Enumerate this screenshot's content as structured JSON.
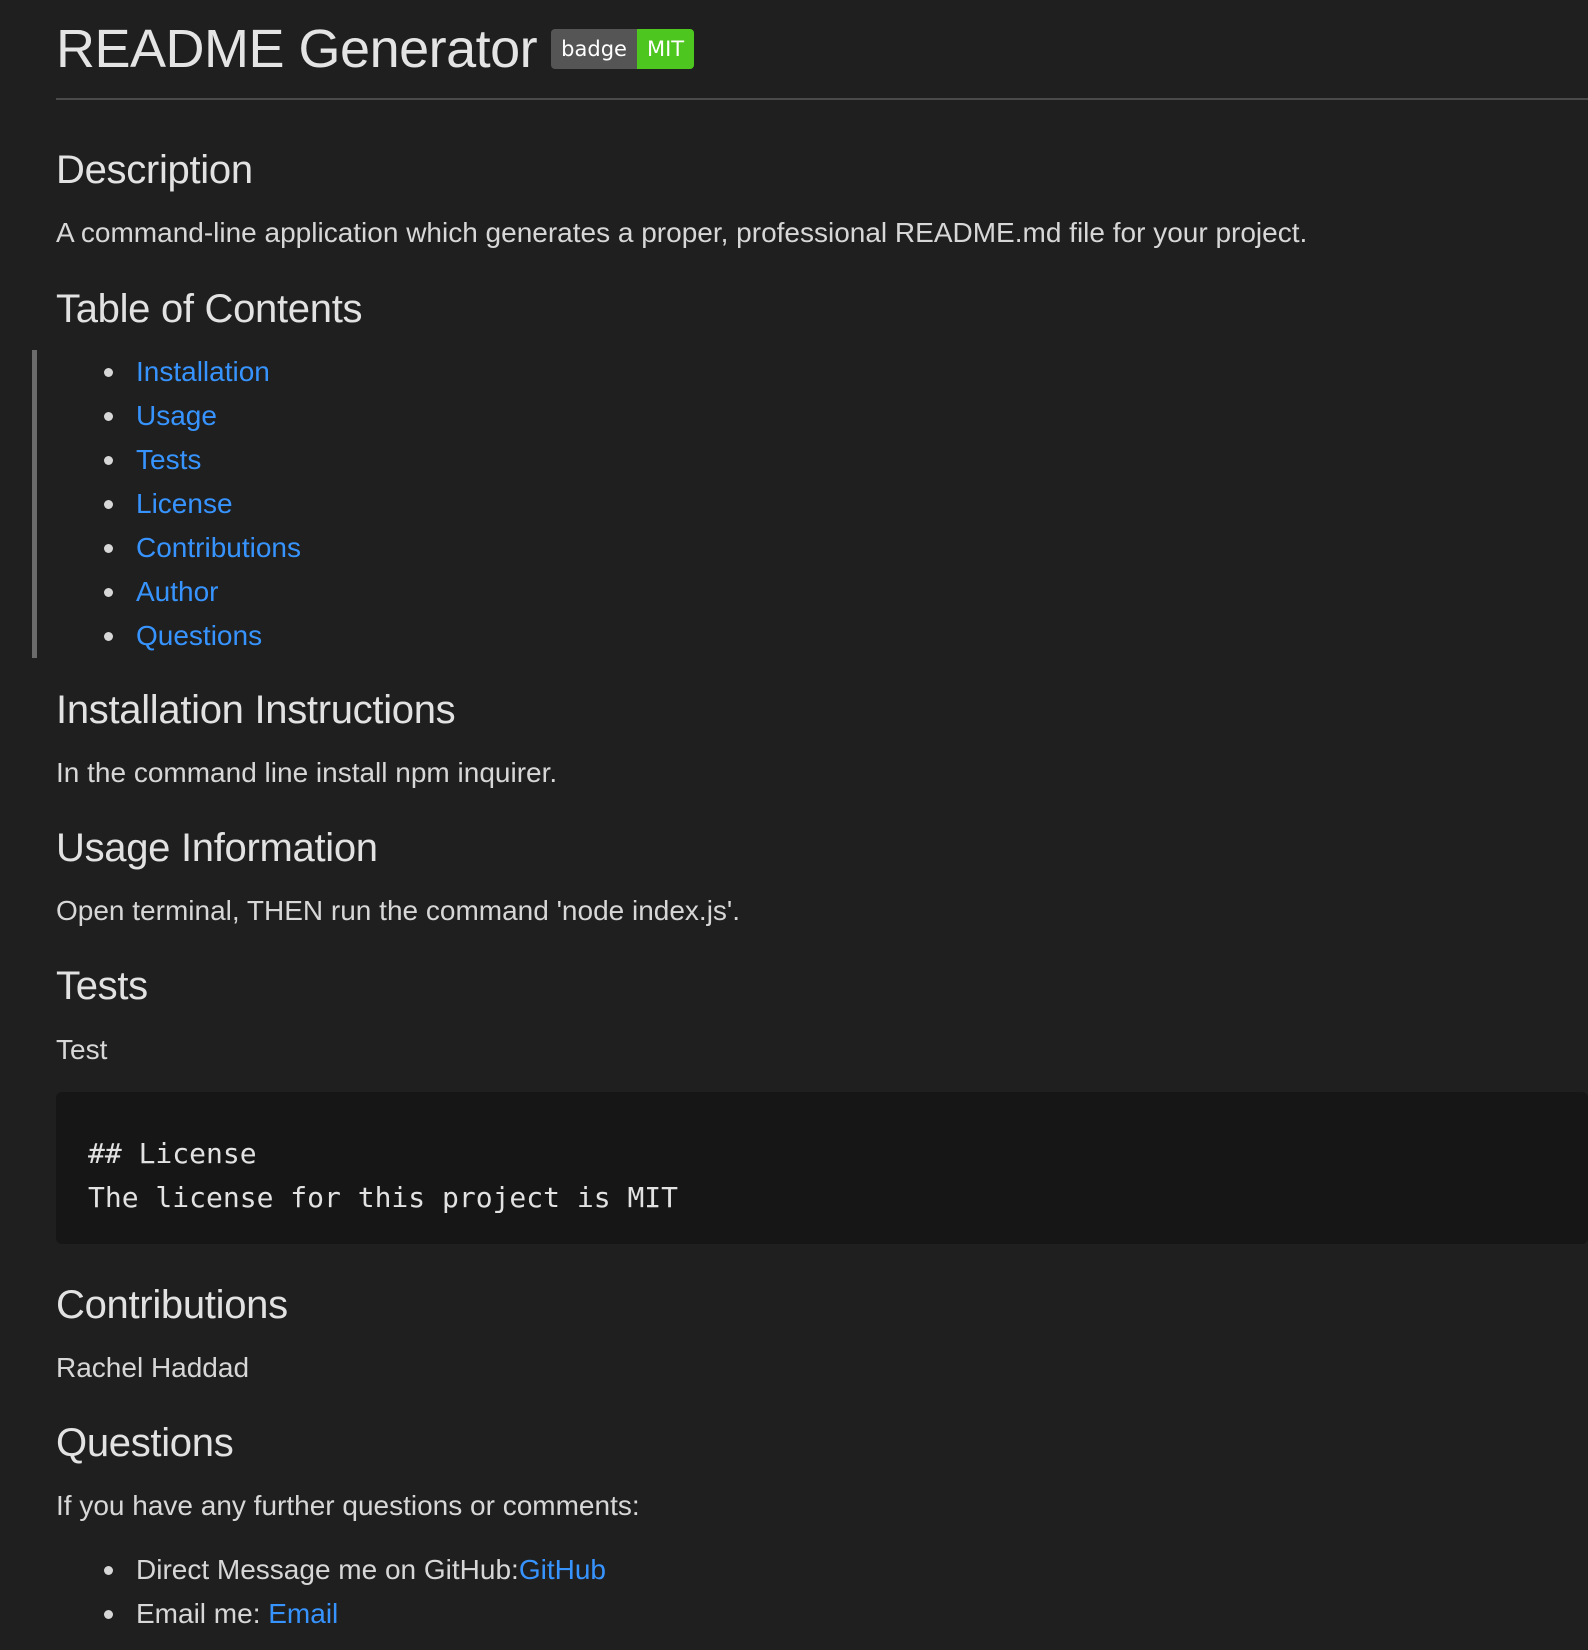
{
  "header": {
    "title": "README Generator",
    "badge_label": "badge",
    "badge_value": "MIT"
  },
  "description": {
    "heading": "Description",
    "text": "A command-line application which generates a proper, professional README.md file for your project."
  },
  "toc": {
    "heading": "Table of Contents",
    "items": [
      "Installation",
      "Usage",
      "Tests",
      "License",
      "Contributions",
      "Author",
      "Questions"
    ]
  },
  "installation": {
    "heading": "Installation Instructions",
    "text": "In the command line install npm inquirer."
  },
  "usage": {
    "heading": "Usage Information",
    "text": "Open terminal, THEN run the command 'node index.js'."
  },
  "tests": {
    "heading": "Tests",
    "text": "Test"
  },
  "code_block": {
    "lines": [
      "## License",
      "The license for this project is MIT"
    ]
  },
  "contributions": {
    "heading": "Contributions",
    "text": "Rachel Haddad"
  },
  "questions": {
    "heading": "Questions",
    "text": "If you have any further questions or comments:",
    "items": [
      {
        "prefix": "Direct Message me on GitHub:",
        "link": "GitHub"
      },
      {
        "prefix": "Email me: ",
        "link": "Email"
      }
    ]
  },
  "colors": {
    "background": "#1f1f1f",
    "link": "#3794ff",
    "badge_left": "#555555",
    "badge_right": "#4dc71f",
    "code_background": "#161616"
  }
}
